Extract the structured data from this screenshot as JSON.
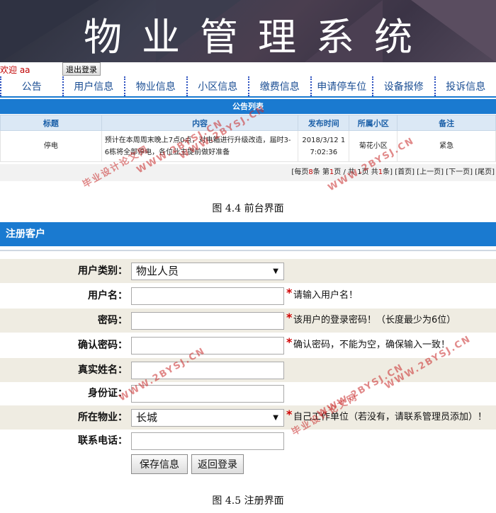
{
  "banner": {
    "title": "物业管理系统"
  },
  "session": {
    "welcome": "欢迎 aa",
    "logout_label": "退出登录"
  },
  "nav": {
    "items": [
      {
        "label": "公告"
      },
      {
        "label": "用户信息"
      },
      {
        "label": "物业信息"
      },
      {
        "label": "小区信息"
      },
      {
        "label": "缴费信息"
      },
      {
        "label": "申请停车位"
      },
      {
        "label": "设备报修"
      },
      {
        "label": "投诉信息"
      }
    ]
  },
  "notice": {
    "header": "公告列表",
    "columns": [
      "标题",
      "内容",
      "发布时间",
      "所属小区",
      "备注"
    ],
    "rows": [
      {
        "title": "停电",
        "content": "预计在本周周末晚上7点0点，对电箱进行升级改造，届时3-6栋将全部停电，各位业主提前做好准备",
        "time": "2018/3/12 17:02:36",
        "community": "菊花小区",
        "remark": "紧急"
      }
    ],
    "pager": {
      "prefix": "[每页",
      "per_page": "8",
      "mid1": "条 第",
      "page": "1",
      "mid2": "页 / 共 1页 共",
      "total": "1",
      "suffix": "条]",
      "first": "[首页]",
      "prev": "[上一页]",
      "next": "[下一页]",
      "last": "[尾页]"
    }
  },
  "captions": {
    "fig1": "图 4.4 前台界面",
    "fig2": "图 4.5 注册界面"
  },
  "register": {
    "header": "注册客户",
    "fields": {
      "user_type": {
        "label": "用户类别：",
        "value": "物业人员"
      },
      "username": {
        "label": "用户名：",
        "value": "",
        "hint": "请输入用户名！"
      },
      "password": {
        "label": "密码：",
        "value": "",
        "hint": "该用户的登录密码！（长度最少为6位）"
      },
      "confirm": {
        "label": "确认密码：",
        "value": "",
        "hint": "确认密码，不能为空，确保输入一致！"
      },
      "realname": {
        "label": "真实姓名：",
        "value": ""
      },
      "idcard": {
        "label": "身份证：",
        "value": ""
      },
      "property": {
        "label": "所在物业：",
        "value": "长城",
        "hint": "自己工作单位（若没有，请联系管理员添加）！"
      },
      "phone": {
        "label": "联系电话：",
        "value": ""
      }
    },
    "save_label": "保存信息",
    "back_label": "返回登录"
  },
  "watermarks": {
    "site": "WWW.2BYSJ.CN",
    "name": "毕业设计论文网"
  },
  "colors": {
    "accent": "#1a7ad0",
    "nav_text": "#1c4f94",
    "warn": "#d00000",
    "alt_row": "#efece2"
  }
}
